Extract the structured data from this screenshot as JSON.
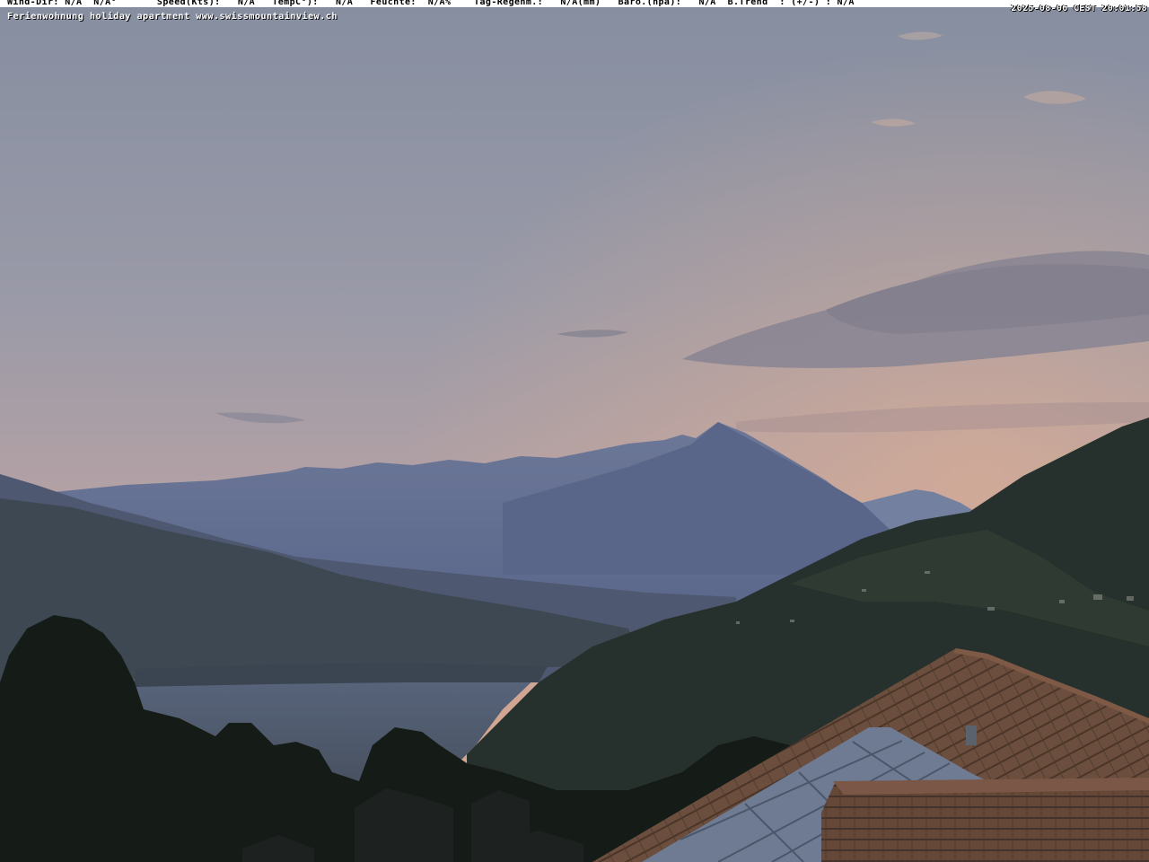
{
  "overlay": {
    "weather_line": "Wind-Dir: N/A  N/A°       Speed(Kts):   N/A   TempC°):   N/A   Feuchte:  N/A%    Tag-Regenm.:   N/A(mm)   Baro.(hpa):   N/A  B.Trend  : (+/-) : N/A",
    "timestamp": "2025-08-06 CEST 20:01:58",
    "caption": "Ferienwohnung holiday apartment www.swissmountainview.ch"
  },
  "colors": {
    "sky_top": "#8a92a4",
    "sky_mid": "#a4a0ab",
    "sky_glow": "#d7a98e",
    "mountain_far": "#6f7a99",
    "mountain_near": "#526082",
    "lake": "#4e5a70",
    "forest": "#1c241e",
    "roof": "#6a4d3c",
    "solar_panel": "#6c7890"
  }
}
